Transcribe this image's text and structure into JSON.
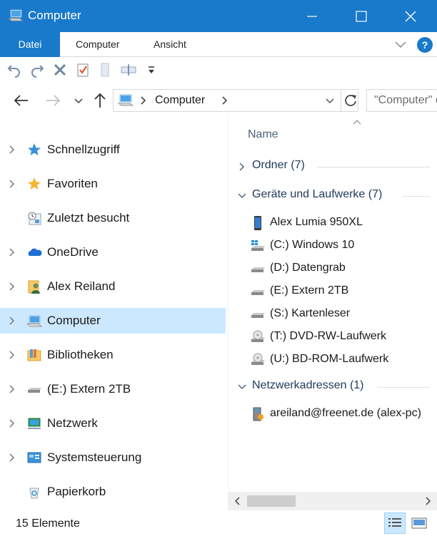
{
  "window": {
    "title": "Computer",
    "icon": "computer-icon",
    "controls": [
      "minimize-icon",
      "maximize-icon",
      "close-icon"
    ]
  },
  "ribbon": {
    "tabs": [
      {
        "label": "Datei",
        "active": true
      },
      {
        "label": "Computer"
      },
      {
        "label": "Ansicht"
      }
    ],
    "help_label": "?"
  },
  "quick_access_toolbar": {
    "buttons": [
      "undo-icon",
      "redo-icon",
      "delete-icon",
      "properties-icon",
      "new-folder-icon",
      "rename-icon",
      "customize-dropdown-icon"
    ]
  },
  "address": {
    "icon": "computer-icon",
    "path": "Computer",
    "search_placeholder": "\"Computer\" durchsuchen"
  },
  "navigation": {
    "items": [
      {
        "label": "Schnellzugriff",
        "icon": "star-icon",
        "expandable": true
      },
      {
        "label": "Favoriten",
        "icon": "star-icon",
        "expandable": true
      },
      {
        "label": "Zuletzt besucht",
        "icon": "recent-icon",
        "expandable": false
      },
      {
        "label": "OneDrive",
        "icon": "cloud-icon",
        "expandable": true
      },
      {
        "label": "Alex Reiland",
        "icon": "user-folder-icon",
        "expandable": true
      },
      {
        "label": "Computer",
        "icon": "computer-icon",
        "expandable": true,
        "selected": true
      },
      {
        "label": "Bibliotheken",
        "icon": "library-icon",
        "expandable": true
      },
      {
        "label": "(E:) Extern 2TB",
        "icon": "drive-icon",
        "expandable": true
      },
      {
        "label": "Netzwerk",
        "icon": "network-icon",
        "expandable": true
      },
      {
        "label": "Systemsteuerung",
        "icon": "control-panel-icon",
        "expandable": true
      },
      {
        "label": "Papierkorb",
        "icon": "recycle-bin-icon",
        "expandable": false
      }
    ]
  },
  "content": {
    "column_header": "Name",
    "groups": [
      {
        "label": "Ordner (7)",
        "expanded": false,
        "items": []
      },
      {
        "label": "Geräte und Laufwerke (7)",
        "expanded": true,
        "items": [
          {
            "label": "Alex Lumia 950XL",
            "icon": "phone-icon"
          },
          {
            "label": "(C:) Windows 10",
            "icon": "windows-drive-icon"
          },
          {
            "label": "(D:) Datengrab",
            "icon": "drive-icon"
          },
          {
            "label": "(E:) Extern 2TB",
            "icon": "drive-icon"
          },
          {
            "label": "(S:) Kartenleser",
            "icon": "drive-icon"
          },
          {
            "label": "(T:) DVD-RW-Laufwerk",
            "icon": "optical-drive-icon"
          },
          {
            "label": "(U:) BD-ROM-Laufwerk",
            "icon": "optical-drive-icon"
          }
        ]
      },
      {
        "label": "Netzwerkadressen (1)",
        "expanded": true,
        "items": [
          {
            "label": "areiland@freenet.de (alex-pc)",
            "icon": "media-server-icon"
          }
        ]
      }
    ]
  },
  "status": {
    "item_count": "15 Elemente",
    "views": [
      "details-view-icon",
      "large-icons-view-icon"
    ]
  },
  "colors": {
    "titlebar": "#1979ca",
    "selection": "#cce8ff",
    "group_text": "#1e395b"
  }
}
